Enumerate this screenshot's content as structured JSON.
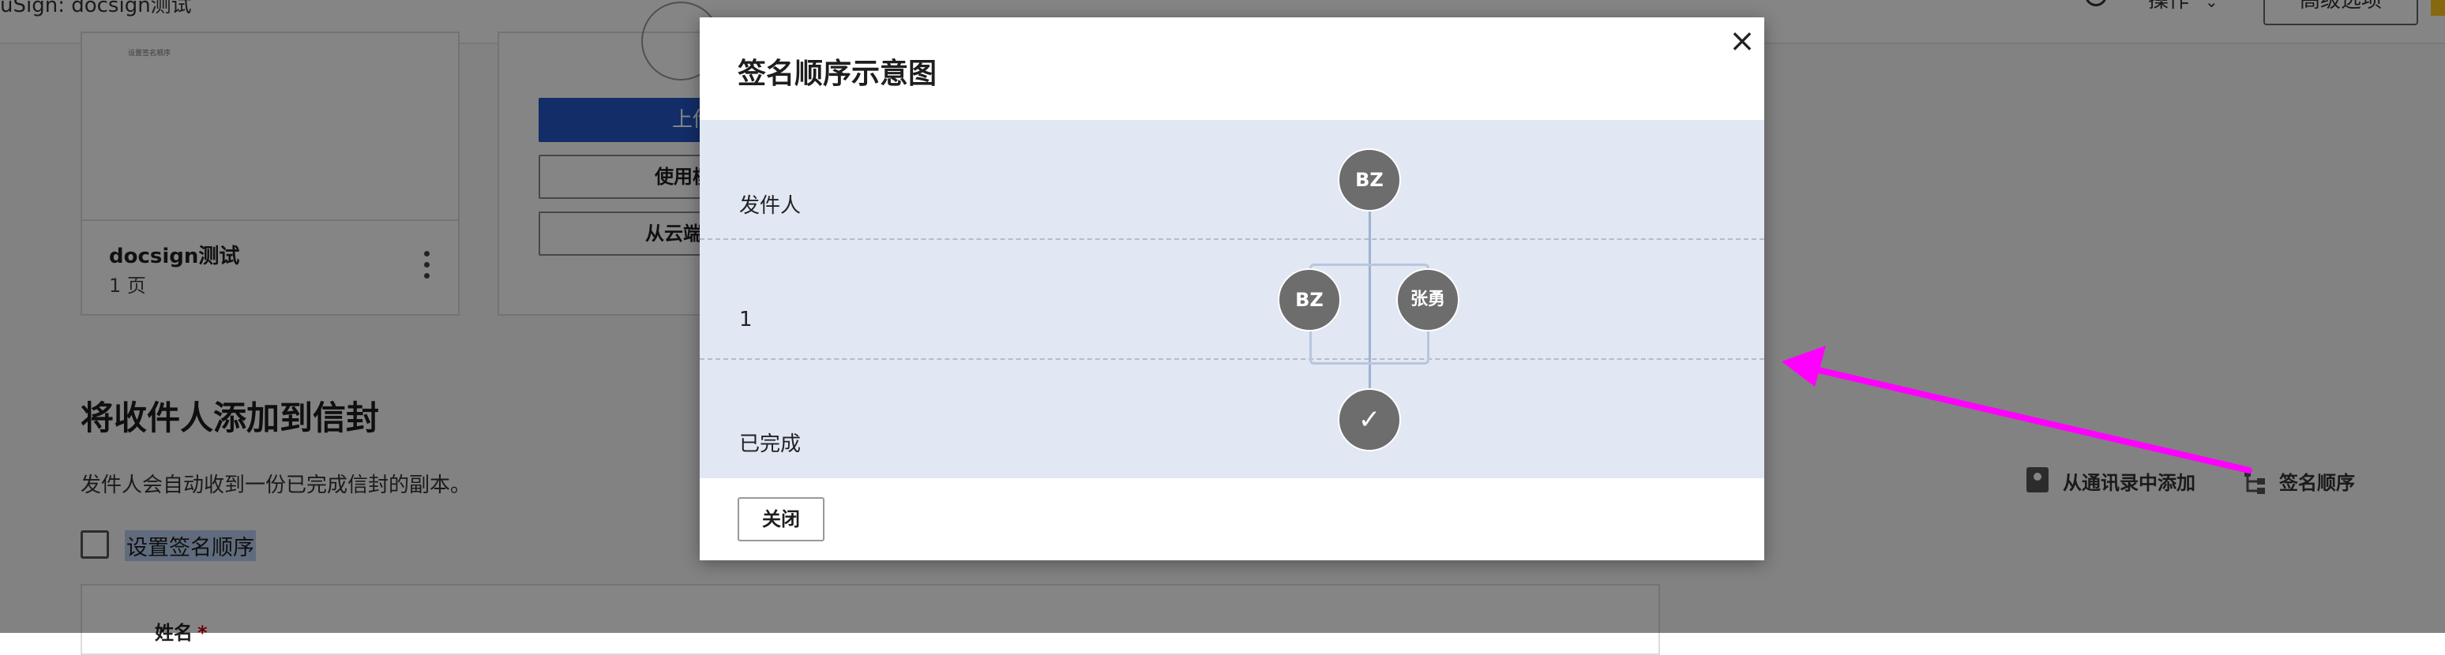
{
  "header": {
    "title": "uSign: docsign测试",
    "actions_label": "操作",
    "advanced_label": "高级选项"
  },
  "document_card": {
    "thumb_text": "设置签名顺序",
    "name": "docsign测试",
    "pages": "1 页"
  },
  "upload_card": {
    "upload_label": "上传",
    "template_label": "使用模板",
    "cloud_label": "从云端获取"
  },
  "recipients": {
    "heading": "将收件人添加到信封",
    "description": "发件人会自动收到一份已完成信封的副本。",
    "set_order_label": "设置签名顺序",
    "name_label": "姓名",
    "required_mark": "*",
    "add_from_contacts": "从通讯录中添加",
    "signing_order_link": "签名顺序"
  },
  "modal": {
    "title": "签名顺序示意图",
    "close_glyph": "×",
    "rows": [
      {
        "label": "发件人"
      },
      {
        "label": "1"
      },
      {
        "label": "已完成"
      }
    ],
    "sender_node": "BZ",
    "signer_nodes": [
      "BZ",
      "张勇"
    ],
    "complete_glyph": "✓",
    "close_button": "关闭"
  },
  "colors": {
    "primary_button": "#2457c5",
    "diagram_bg": "#e1e7f3",
    "node": "#6d6d6d",
    "annotation_arrow": "#ff00ff",
    "highlight": "#b9cff0"
  }
}
